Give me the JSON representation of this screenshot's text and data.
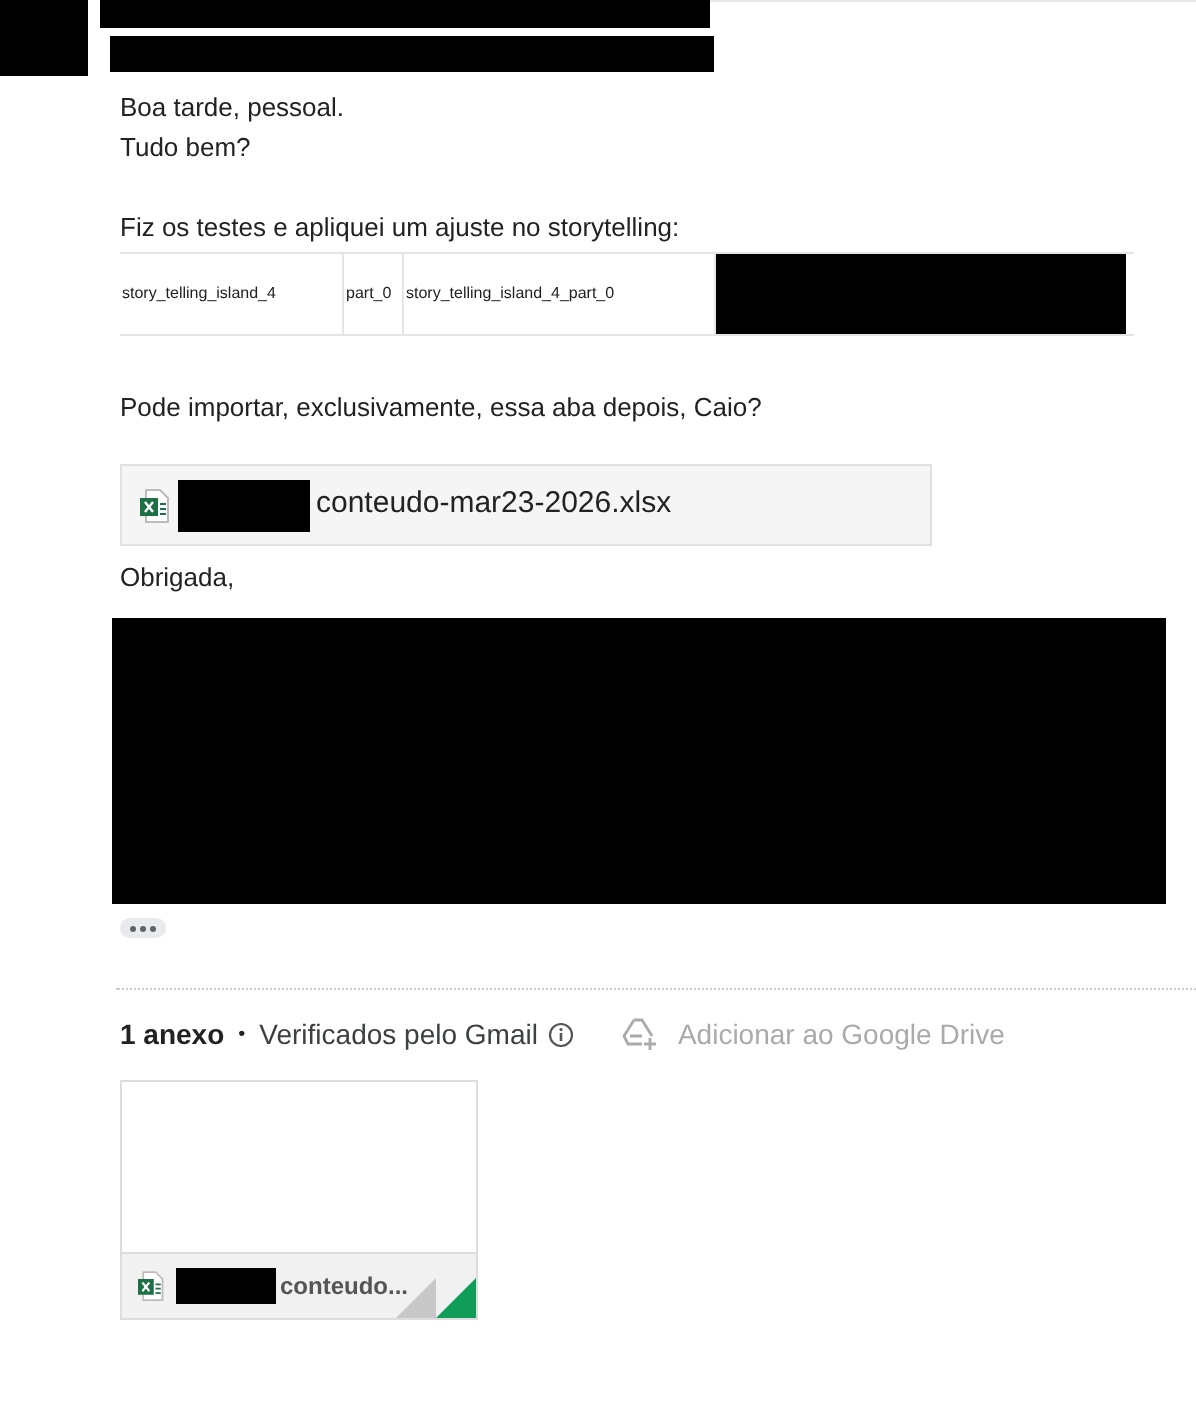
{
  "message": {
    "body_lines": [
      "Boa tarde, pessoal.",
      "Tudo bem?"
    ],
    "intro": "Fiz os testes e apliquei um ajuste no storytelling:",
    "table": {
      "rows": [
        {
          "cells": [
            "story_telling_island_4",
            "part_0",
            "story_telling_island_4_part_0"
          ]
        }
      ]
    },
    "request": "Pode importar, exclusivamente, essa aba depois, Caio?",
    "linked_file": {
      "name": "conteudo-mar23-2026.xlsx"
    },
    "closing": "Obrigada,"
  },
  "attachments": {
    "count": "1 anexo",
    "separator": "•",
    "scan_note": "Verificados pelo Gmail",
    "drive_action": "Adicionar ao Google Drive",
    "items": [
      {
        "name": "conteudo..."
      }
    ]
  }
}
